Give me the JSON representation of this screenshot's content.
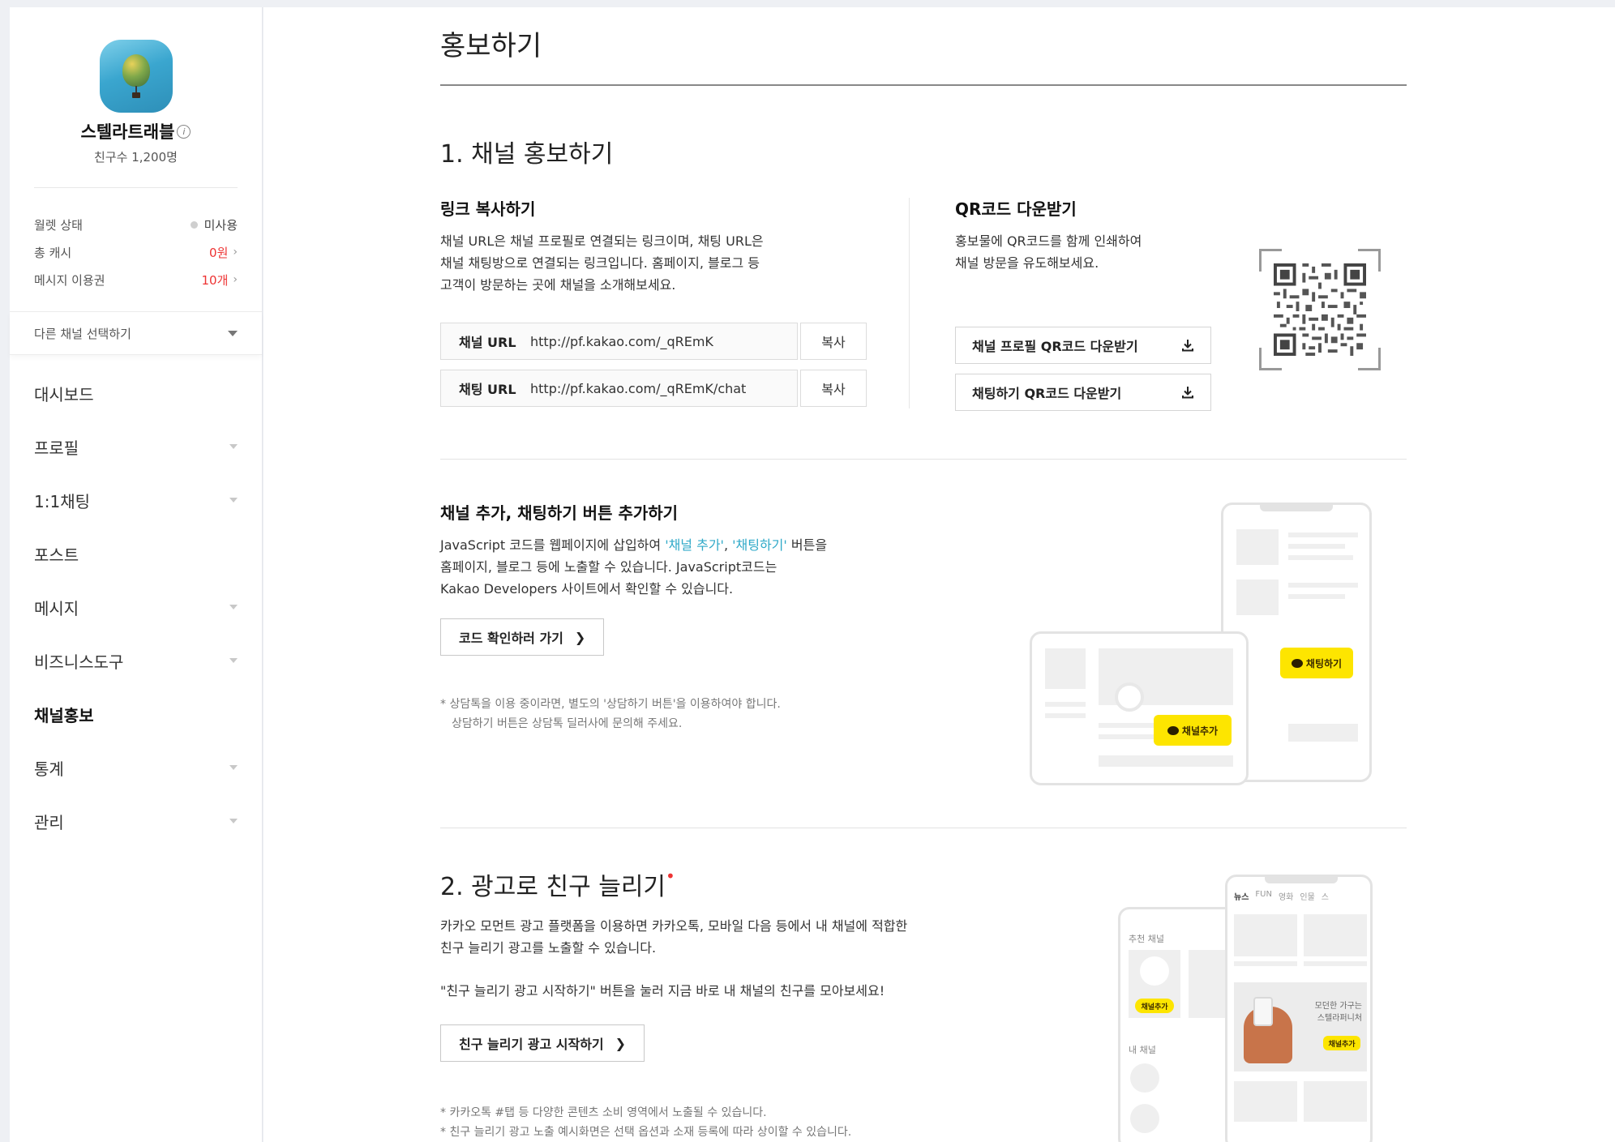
{
  "sidebar": {
    "profile": {
      "name": "스텔라트래블",
      "friends": "친구수  1,200명"
    },
    "stats": [
      {
        "label": "월렛 상태",
        "value": "미사용"
      },
      {
        "label": "총 캐시",
        "value": "0원"
      },
      {
        "label": "메시지 이용권",
        "value": "10개"
      }
    ],
    "channel_select": "다른 채널 선택하기",
    "nav": [
      {
        "label": "대시보드"
      },
      {
        "label": "프로필"
      },
      {
        "label": "1:1채팅"
      },
      {
        "label": "포스트"
      },
      {
        "label": "메시지"
      },
      {
        "label": "비즈니스도구"
      },
      {
        "label": "채널홍보"
      },
      {
        "label": "통계"
      },
      {
        "label": "관리"
      }
    ]
  },
  "main": {
    "title": "홍보하기",
    "section1": {
      "heading": "1. 채널 홍보하기",
      "link": {
        "heading": "링크 복사하기",
        "desc_lines": [
          "채널 URL은 채널 프로필로 연결되는 링크이며, 채팅 URL은",
          "채널 채팅방으로 연결되는 링크입니다. 홈페이지, 블로그 등",
          "고객이 방문하는 곳에 채널을 소개해보세요."
        ],
        "rows": [
          {
            "label": "채널 URL",
            "url": "http://pf.kakao.com/_qREmK",
            "button": "복사"
          },
          {
            "label": "채팅 URL",
            "url": "http://pf.kakao.com/_qREmK/chat",
            "button": "복사"
          }
        ]
      },
      "qr": {
        "heading": "QR코드 다운받기",
        "desc_lines": [
          "홍보물에 QR코드를 함께 인쇄하여",
          "채널 방문을 유도해보세요."
        ],
        "buttons": [
          "채널 프로필 QR코드 다운받기",
          "채팅하기 QR코드 다운받기"
        ]
      },
      "buttons_section": {
        "heading": "채널 추가, 채팅하기 버튼 추가하기",
        "line1_pre": "JavaScript 코드를 웹페이지에 삽입하여 ",
        "line1_link1": "'채널 추가'",
        "line1_sep": ", ",
        "line1_link2": "'채팅하기'",
        "line1_post": " 버튼을",
        "line2": "홈페이지, 블로그 등에 노출할 수 있습니다. JavaScript코드는",
        "line3": "Kakao Developers 사이트에서 확인할 수 있습니다.",
        "cta": "코드 확인하러 가기",
        "notes": [
          "상담톡을 이용 중이라면, 별도의 '상담하기 버튼'을 이용하여야 합니다.",
          "상담하기 버튼은 상담톡 딜러사에 문의해 주세요."
        ],
        "mock_chat": "채팅하기",
        "mock_add": "채널추가"
      }
    },
    "section2": {
      "heading": "2. 광고로 친구 늘리기",
      "desc_lines": [
        "카카오 모먼트 광고 플랫폼을 이용하면 카카오톡, 모바일 다음 등에서 내 채널에 적합한",
        "친구 늘리기 광고를 노출할 수 있습니다."
      ],
      "desc2": "\"친구 늘리기 광고 시작하기\" 버튼을 눌러 지금 바로 내 채널의 친구를 모아보세요!",
      "cta": "친구 늘리기 광고 시작하기",
      "notes": [
        "카카오톡 #탭 등 다양한 콘텐츠 소비 영역에서 노출될 수 있습니다.",
        "친구 늘리기 광고 노출 예시화면은 선택 옵션과 소재 등록에 따라 상이할 수 있습니다."
      ],
      "mock": {
        "tabs": [
          "뉴스",
          "FUN",
          "영화",
          "인물",
          "스"
        ],
        "recommended": "추천 채널",
        "my_channels": "내 채널",
        "add_label": "채널추가",
        "ad_text_1": "모던한 가구는",
        "ad_text_2": "스텔라퍼니처",
        "ad_add": "채널추가"
      }
    }
  },
  "colors": {
    "accent_cyan": "#2fa9c8",
    "kakao_yellow": "#fde500",
    "red": "#ee3333"
  }
}
